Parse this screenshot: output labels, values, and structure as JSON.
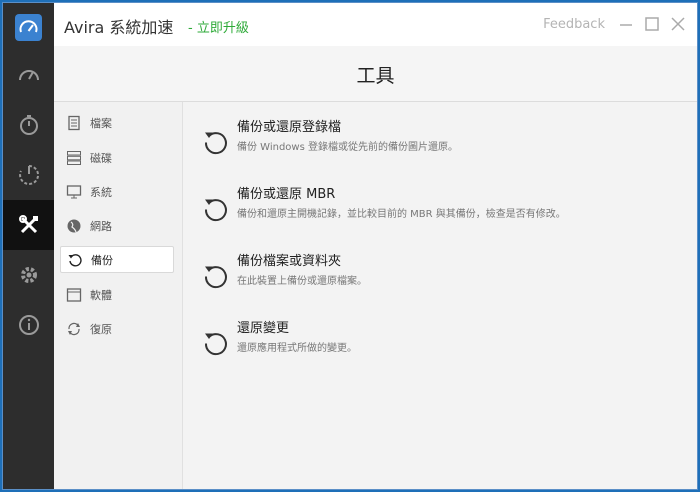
{
  "app": {
    "title": "Avira 系統加速",
    "upgrade_label": "- 立即升級",
    "feedback_label": "Feedback"
  },
  "rail": {
    "items": [
      {
        "icon": "speedometer-icon"
      },
      {
        "icon": "stopwatch-icon"
      },
      {
        "icon": "power-cycle-icon"
      },
      {
        "icon": "tools-icon",
        "active": true
      },
      {
        "icon": "gear-icon"
      },
      {
        "icon": "info-icon"
      }
    ]
  },
  "header": {
    "title": "工具"
  },
  "subnav": {
    "items": [
      {
        "label": "檔案",
        "icon": "document-icon"
      },
      {
        "label": "磁碟",
        "icon": "disk-stack-icon"
      },
      {
        "label": "系統",
        "icon": "monitor-icon"
      },
      {
        "label": "網路",
        "icon": "globe-icon"
      },
      {
        "label": "備份",
        "icon": "restore-arrow-icon",
        "active": true
      },
      {
        "label": "軟體",
        "icon": "window-icon"
      },
      {
        "label": "復原",
        "icon": "recycle-icon"
      }
    ]
  },
  "tools": [
    {
      "title": "備份或還原登錄檔",
      "desc": "備份 Windows 登錄檔或從先前的備份圖片還原。"
    },
    {
      "title": "備份或還原 MBR",
      "desc": "備份和還原主開機記錄，並比較目前的 MBR 與其備份，檢查是否有修改。"
    },
    {
      "title": "備份檔案或資料夾",
      "desc": "在此裝置上備份或還原檔案。"
    },
    {
      "title": "還原變更",
      "desc": "還原應用程式所做的變更。"
    }
  ],
  "colors": {
    "rail_bg": "#2d2d2d",
    "accent_blue": "#3b82d0",
    "upgrade_green": "#2eaa38",
    "desktop_blue": "#1e6fb8"
  }
}
